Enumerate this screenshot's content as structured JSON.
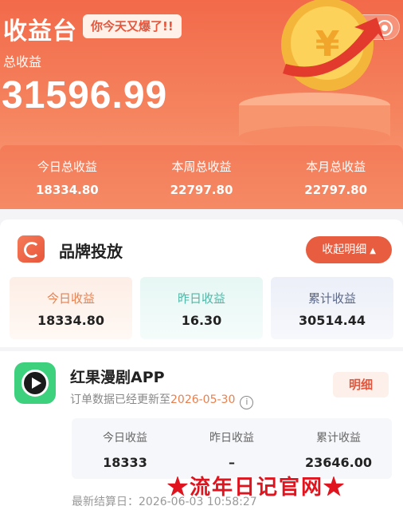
{
  "header": {
    "title": "收益台",
    "badge": "你今天又爆了!!",
    "capsule_more_icon": "more-dots-icon",
    "capsule_close_icon": "target-circle-icon",
    "total_label": "总收益",
    "total_value": "31596.99"
  },
  "summary": [
    {
      "label": "今日总收益",
      "value": "18334.80"
    },
    {
      "label": "本周总收益",
      "value": "22797.80"
    },
    {
      "label": "本月总收益",
      "value": "22797.80"
    }
  ],
  "brand": {
    "title": "品牌投放",
    "collapse_label": "收起明细",
    "stats": [
      {
        "label": "今日收益",
        "value": "18334.80"
      },
      {
        "label": "昨日收益",
        "value": "16.30"
      },
      {
        "label": "累计收益",
        "value": "30514.44"
      }
    ]
  },
  "app": {
    "name": "红果漫剧APP",
    "update_prefix": "订单数据已经更新至",
    "update_date": "2026-05-30",
    "detail_label": "明细",
    "stats": [
      {
        "label": "今日收益",
        "value": "18333"
      },
      {
        "label": "昨日收益",
        "value": "–"
      },
      {
        "label": "累计收益",
        "value": "23646.00"
      }
    ],
    "settle_text": "最新结算日：2026-06-03 10:58:27"
  },
  "watermark": "★流年日记官网★",
  "colors": {
    "accent": "#e85d40",
    "header": "#f26a4a"
  }
}
